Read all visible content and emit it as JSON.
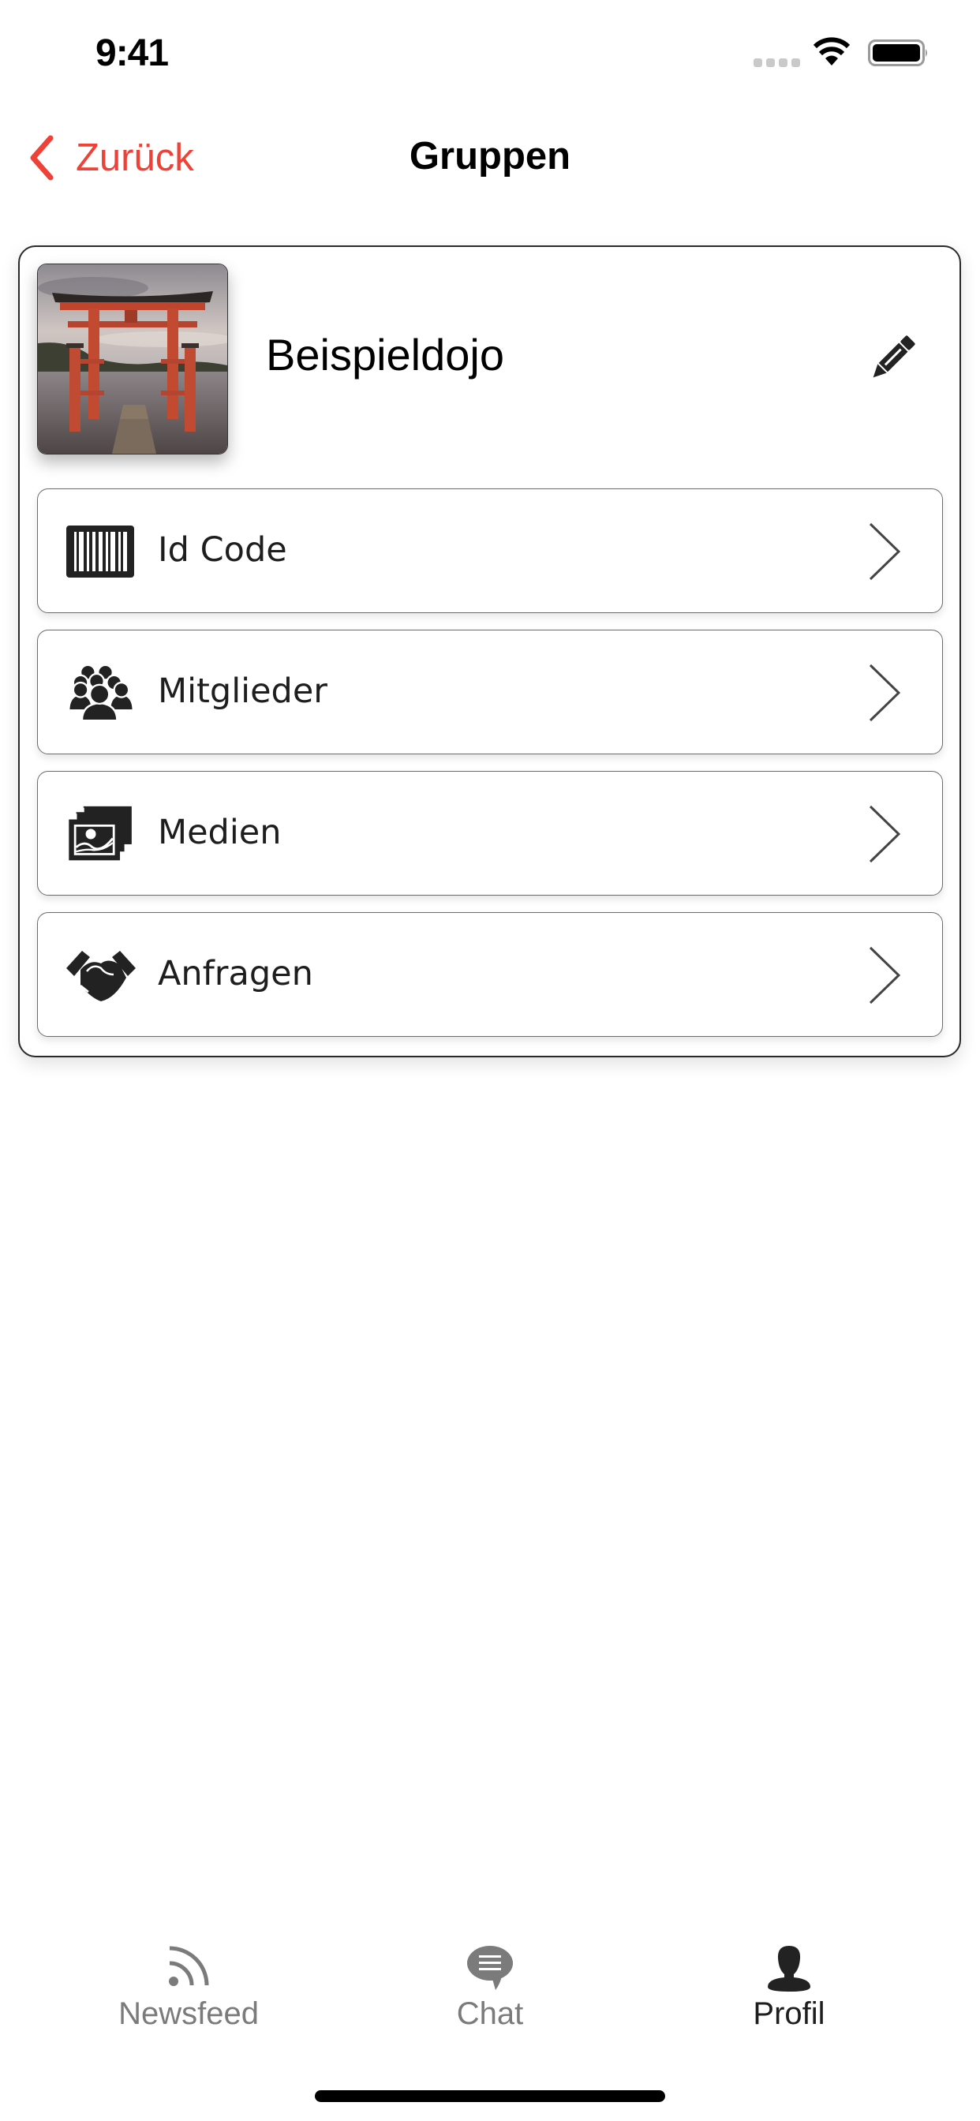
{
  "status_bar": {
    "time": "9:41",
    "icons": [
      "signal-dots-icon",
      "wifi-icon",
      "battery-icon"
    ]
  },
  "nav": {
    "back_label": "Zurück",
    "back_icon": "chevron-left-icon",
    "title": "Gruppen"
  },
  "colors": {
    "accent": "#ee4137",
    "text": "#1e1e1e",
    "tab_inactive": "#7b7b7b",
    "tab_active": "#1e1e1e"
  },
  "group": {
    "name": "Beispieldojo",
    "image": "torii-gate-photo",
    "edit_icon": "pencil-icon"
  },
  "menu": {
    "items": [
      {
        "label": "Id Code",
        "icon": "barcode-icon"
      },
      {
        "label": "Mitglieder",
        "icon": "group-members-icon"
      },
      {
        "label": "Medien",
        "icon": "media-gallery-icon"
      },
      {
        "label": "Anfragen",
        "icon": "handshake-icon"
      }
    ]
  },
  "tabs": [
    {
      "label": "Newsfeed",
      "icon": "rss-feed-icon",
      "active": false
    },
    {
      "label": "Chat",
      "icon": "chat-bubble-icon",
      "active": false
    },
    {
      "label": "Profil",
      "icon": "person-icon",
      "active": true
    }
  ]
}
